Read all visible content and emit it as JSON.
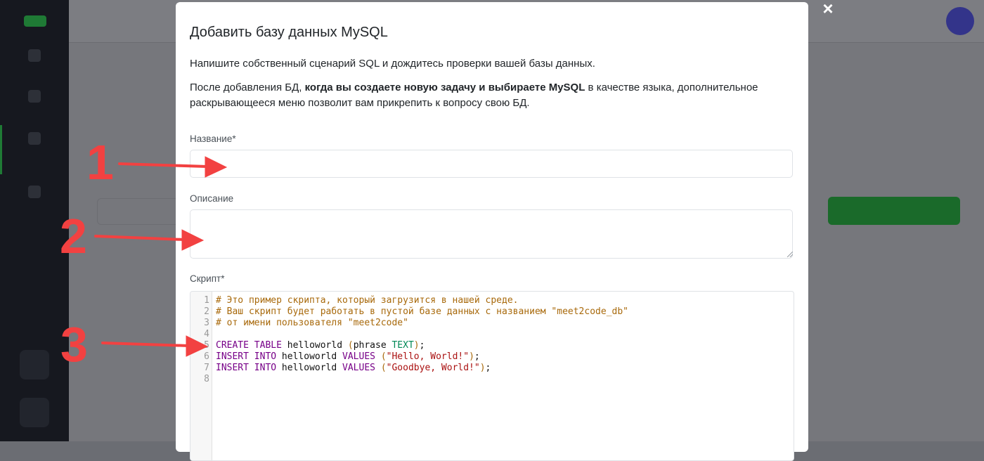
{
  "modal": {
    "title": "Добавить базу данных MySQL",
    "para1": "Напишите собственный сценарий SQL и дождитесь проверки вашей базы данных.",
    "para2_before": "После добавления БД, ",
    "para2_bold": "когда вы создаете новую задачу и выбираете MySQL",
    "para2_after": " в качестве языка, дополнительное раскрывающееся меню позволит вам прикрепить к вопросу свою БД.",
    "name_label": "Название*",
    "name_value": "",
    "description_label": "Описание",
    "description_value": "",
    "script_label": "Скрипт*",
    "close_glyph": "×"
  },
  "editor": {
    "line_numbers": [
      "1",
      "2",
      "3",
      "4",
      "5",
      "6",
      "7",
      "8"
    ],
    "lines": [
      [
        {
          "t": "# Это пример скрипта, который загрузится в нашей среде.",
          "c": "comment"
        }
      ],
      [
        {
          "t": "# Ваш скрипт будет работать в пустой базе данных с названием \"meet2code_db\"",
          "c": "comment"
        }
      ],
      [
        {
          "t": "# от имени пользователя \"meet2code\"",
          "c": "comment"
        }
      ],
      [],
      [
        {
          "t": "CREATE",
          "c": "kw"
        },
        {
          "t": " ",
          "c": "punc"
        },
        {
          "t": "TABLE",
          "c": "kw"
        },
        {
          "t": " helloworld ",
          "c": "punc"
        },
        {
          "t": "(",
          "c": "comment"
        },
        {
          "t": "phrase ",
          "c": "punc"
        },
        {
          "t": "TEXT",
          "c": "type"
        },
        {
          "t": ")",
          "c": "comment"
        },
        {
          "t": ";",
          "c": "punc"
        }
      ],
      [
        {
          "t": "INSERT",
          "c": "kw"
        },
        {
          "t": " ",
          "c": "punc"
        },
        {
          "t": "INTO",
          "c": "kw"
        },
        {
          "t": " helloworld ",
          "c": "punc"
        },
        {
          "t": "VALUES",
          "c": "kw"
        },
        {
          "t": " ",
          "c": "punc"
        },
        {
          "t": "(",
          "c": "comment"
        },
        {
          "t": "\"Hello, World!\"",
          "c": "str"
        },
        {
          "t": ")",
          "c": "comment"
        },
        {
          "t": ";",
          "c": "punc"
        }
      ],
      [
        {
          "t": "INSERT",
          "c": "kw"
        },
        {
          "t": " ",
          "c": "punc"
        },
        {
          "t": "INTO",
          "c": "kw"
        },
        {
          "t": " helloworld ",
          "c": "punc"
        },
        {
          "t": "VALUES",
          "c": "kw"
        },
        {
          "t": " ",
          "c": "punc"
        },
        {
          "t": "(",
          "c": "comment"
        },
        {
          "t": "\"Goodbye, World!\"",
          "c": "str"
        },
        {
          "t": ")",
          "c": "comment"
        },
        {
          "t": ";",
          "c": "punc"
        }
      ],
      []
    ]
  },
  "annotations": [
    {
      "label": "1",
      "points_to": "name-input"
    },
    {
      "label": "2",
      "points_to": "description-textarea"
    },
    {
      "label": "3",
      "points_to": "script-editor"
    }
  ],
  "colors": {
    "annotation": "#f24141",
    "comment": "#a8690b",
    "keyword": "#770088",
    "type": "#008855",
    "string": "#aa1111",
    "overlay": "#6b6d73"
  }
}
